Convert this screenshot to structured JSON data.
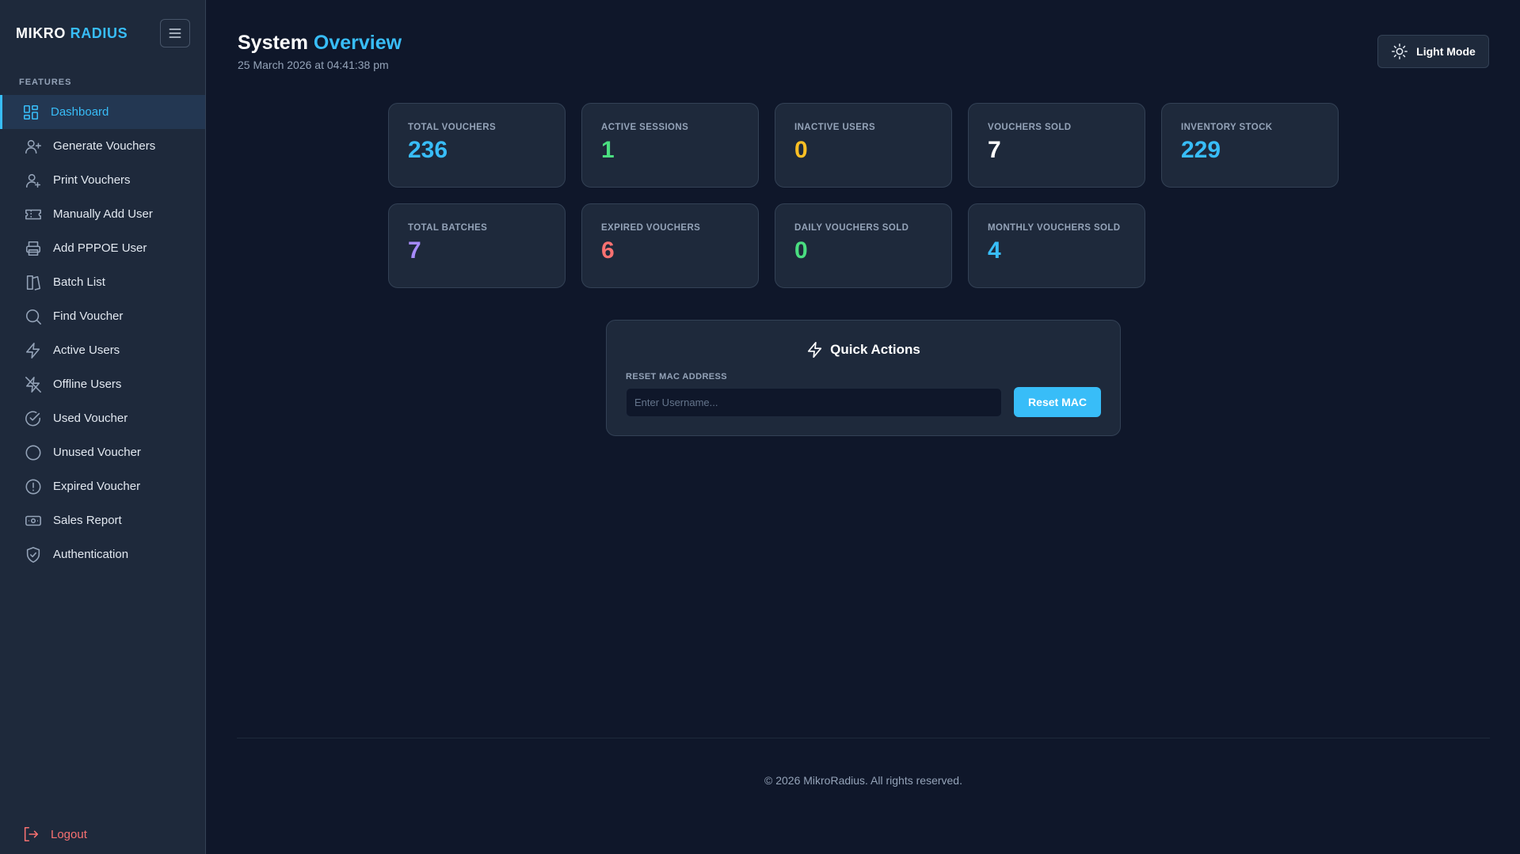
{
  "brand": {
    "word1": "MIKRO",
    "word2": "RADIUS"
  },
  "sidebar": {
    "section_label": "FEATURES",
    "items": [
      {
        "label": "Dashboard",
        "icon": "dashboard-grid-icon",
        "active": true
      },
      {
        "label": "Generate Vouchers",
        "icon": "user-plus-icon"
      },
      {
        "label": "Print Vouchers",
        "icon": "user-icon"
      },
      {
        "label": "Manually Add User",
        "icon": "ticket-icon"
      },
      {
        "label": "Add PPPOE User",
        "icon": "printer-icon"
      },
      {
        "label": "Batch List",
        "icon": "book-open-icon"
      },
      {
        "label": "Find Voucher",
        "icon": "search-icon"
      },
      {
        "label": "Active Users",
        "icon": "lightning-icon"
      },
      {
        "label": "Offline Users",
        "icon": "lightning-off-icon"
      },
      {
        "label": "Used Voucher",
        "icon": "check-circle-icon"
      },
      {
        "label": "Unused Voucher",
        "icon": "circle-icon"
      },
      {
        "label": "Expired Voucher",
        "icon": "alert-circle-icon"
      },
      {
        "label": "Sales Report",
        "icon": "money-icon"
      },
      {
        "label": "Authentication",
        "icon": "shield-check-icon"
      }
    ],
    "logout_label": "Logout"
  },
  "header": {
    "title_part1": "System",
    "title_part2": "Overview",
    "timestamp": "25 March 2026 at 04:41:38 pm",
    "mode_button": "Light Mode"
  },
  "stats": [
    {
      "label": "TOTAL VOUCHERS",
      "value": "236",
      "color": "#38bdf8"
    },
    {
      "label": "ACTIVE SESSIONS",
      "value": "1",
      "color": "#4ade80"
    },
    {
      "label": "INACTIVE USERS",
      "value": "0",
      "color": "#fbbf24"
    },
    {
      "label": "VOUCHERS SOLD",
      "value": "7",
      "color": "#ffffff"
    },
    {
      "label": "INVENTORY STOCK",
      "value": "229",
      "color": "#38bdf8"
    },
    {
      "label": "TOTAL BATCHES",
      "value": "7",
      "color": "#a78bfa"
    },
    {
      "label": "EXPIRED VOUCHERS",
      "value": "6",
      "color": "#f87171"
    },
    {
      "label": "DAILY VOUCHERS SOLD",
      "value": "0",
      "color": "#4ade80"
    },
    {
      "label": "MONTHLY VOUCHERS SOLD",
      "value": "4",
      "color": "#38bdf8"
    }
  ],
  "quick_actions": {
    "title": "Quick Actions",
    "field_label": "RESET MAC ADDRESS",
    "placeholder": "Enter Username...",
    "button": "Reset MAC"
  },
  "footer": "© 2026 MikroRadius. All rights reserved."
}
